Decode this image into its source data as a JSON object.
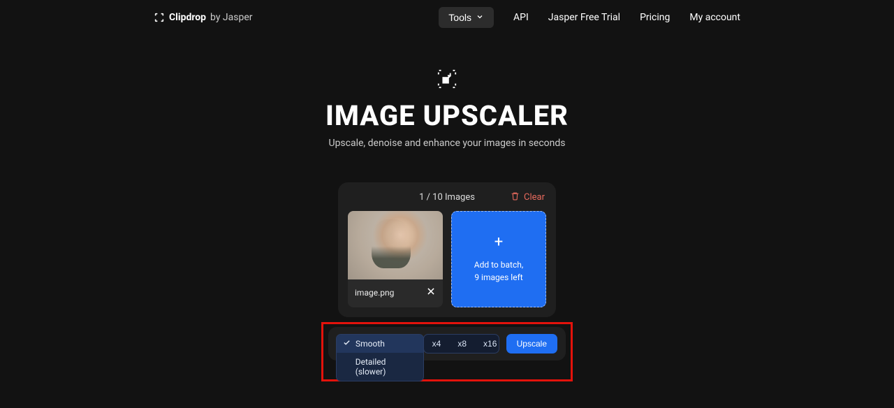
{
  "brand": {
    "main": "Clipdrop",
    "sub": "by Jasper"
  },
  "nav": {
    "tools": "Tools",
    "api": "API",
    "trial": "Jasper Free Trial",
    "pricing": "Pricing",
    "account": "My account"
  },
  "hero": {
    "title": "IMAGE UPSCALER",
    "sub": "Upscale, denoise and enhance your images in seconds"
  },
  "panel": {
    "count": "1 / 10 Images",
    "clear": "Clear",
    "thumb_name": "image.png",
    "add_line1": "Add to batch,",
    "add_line2": "9 images left"
  },
  "controls": {
    "mode_smooth": "Smooth",
    "mode_detailed": "Detailed (slower)",
    "x4": "x4",
    "x8": "x8",
    "x16": "x16",
    "upscale": "Upscale"
  }
}
